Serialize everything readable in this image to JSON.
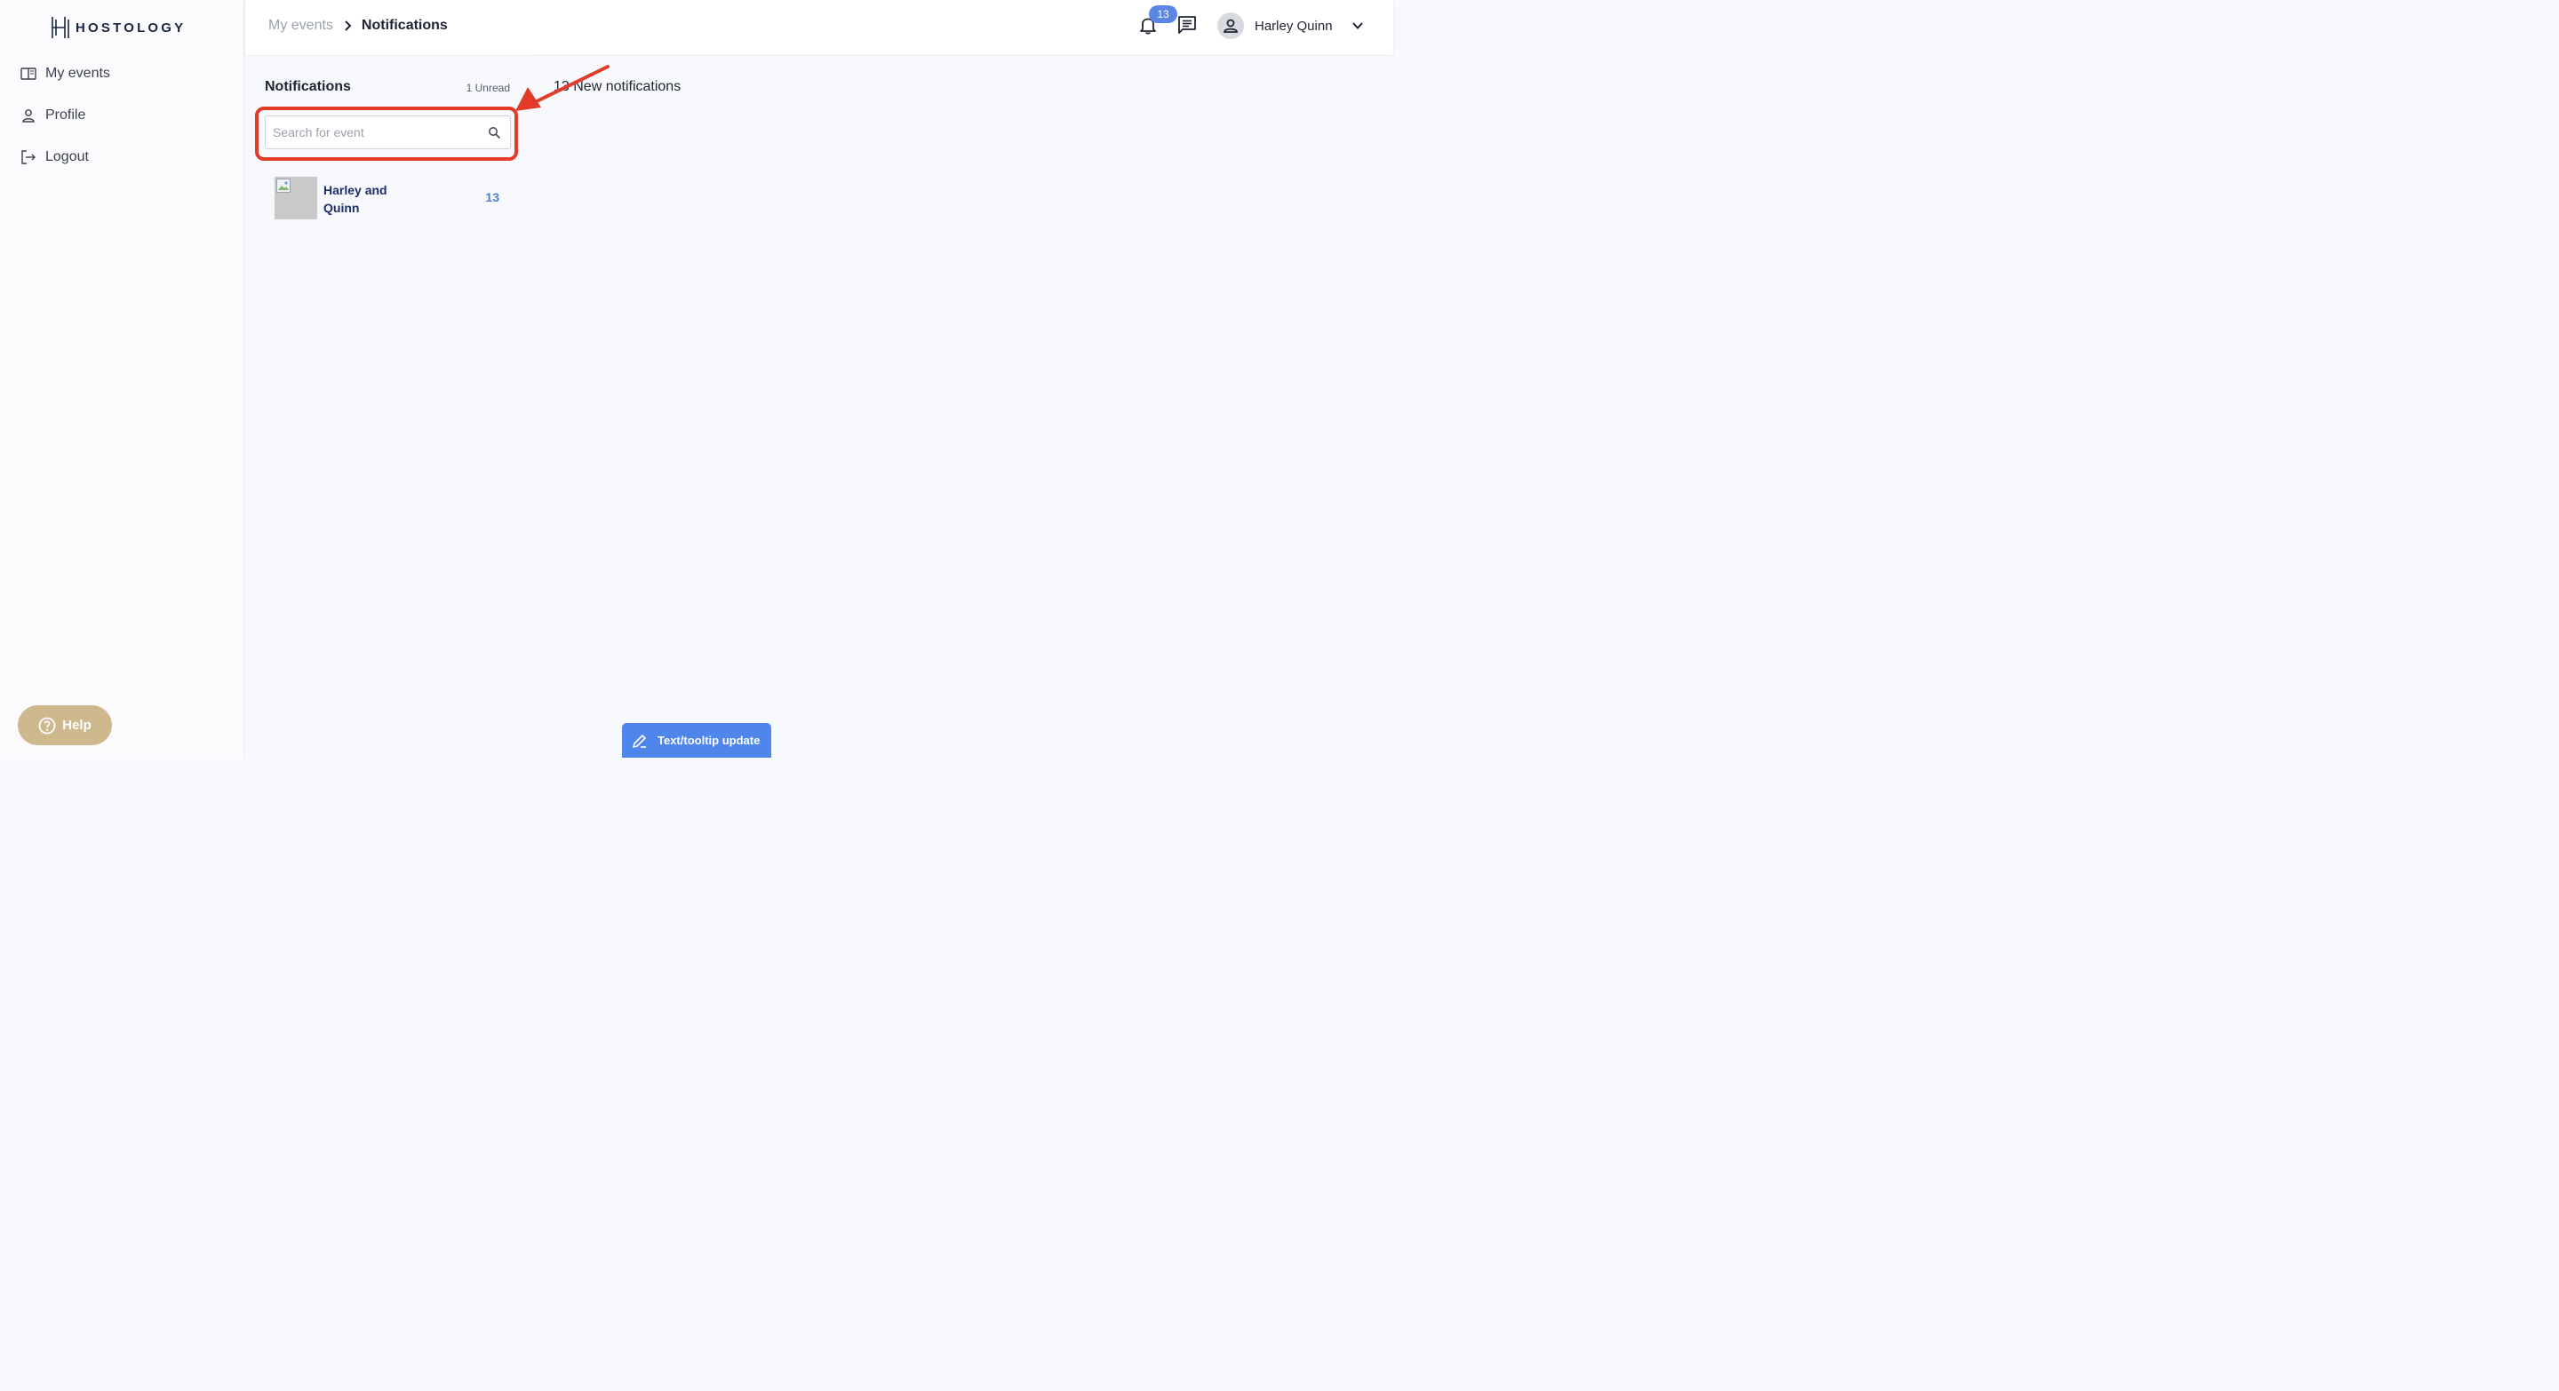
{
  "brand": {
    "name": "HOSTOLOGY"
  },
  "sidebar": {
    "items": [
      {
        "label": "My events",
        "icon": "book-icon"
      },
      {
        "label": "Profile",
        "icon": "person-icon"
      },
      {
        "label": "Logout",
        "icon": "logout-icon"
      }
    ],
    "help_label": "Help"
  },
  "header": {
    "breadcrumb": {
      "parent": "My events",
      "current": "Notifications"
    },
    "notifications_badge": "13",
    "user_name": "Harley Quinn"
  },
  "notifications_panel": {
    "title": "Notifications",
    "unread": "1 Unread",
    "search": {
      "placeholder": "Search for event",
      "value": ""
    },
    "events": [
      {
        "name": "Harley and Quinn",
        "count": "13"
      }
    ]
  },
  "main": {
    "new_notifications": "13 New notifications"
  },
  "floating_button": {
    "label": "Text/tooltip update"
  },
  "colors": {
    "accent": "#5b86e5",
    "help": "#cdb98d",
    "annotation": "#e23b2a",
    "event_name": "#1d2f6b"
  }
}
